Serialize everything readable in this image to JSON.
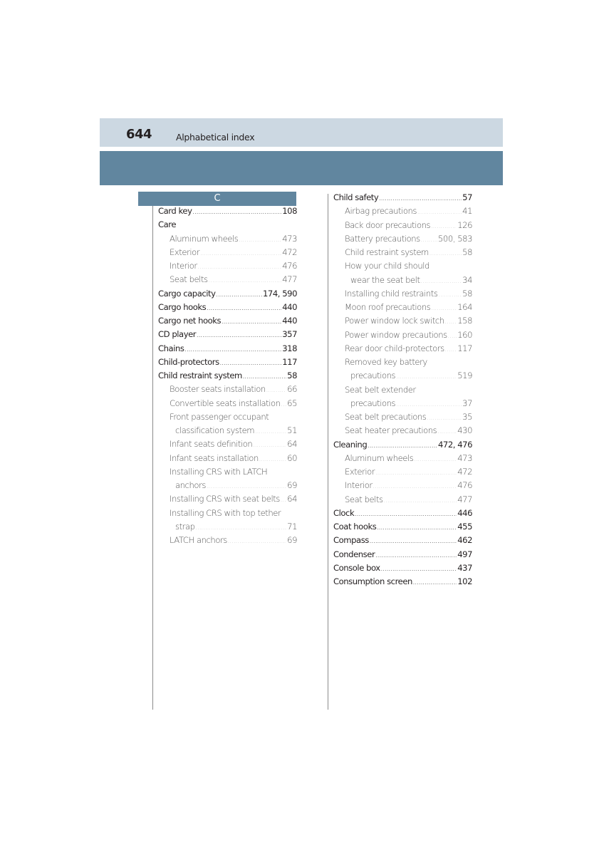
{
  "header": {
    "page_number": "644",
    "section_title": "Alphabetical index"
  },
  "letter": "C",
  "colors": {
    "header_light": "#ccd8e2",
    "header_dark": "#61869f"
  },
  "left_column": [
    {
      "label": "Card key",
      "page": "108",
      "level": 0
    },
    {
      "label": "Care",
      "page": "",
      "level": 0
    },
    {
      "label": "Aluminum wheels",
      "page": "473",
      "level": 1
    },
    {
      "label": "Exterior",
      "page": "472",
      "level": 1
    },
    {
      "label": "Interior",
      "page": "476",
      "level": 1
    },
    {
      "label": "Seat belts",
      "page": "477",
      "level": 1
    },
    {
      "label": "Cargo capacity",
      "page": "174, 590",
      "level": 0
    },
    {
      "label": "Cargo hooks",
      "page": "440",
      "level": 0
    },
    {
      "label": "Cargo net hooks",
      "page": "440",
      "level": 0
    },
    {
      "label": "CD player",
      "page": "357",
      "level": 0
    },
    {
      "label": "Chains",
      "page": "318",
      "level": 0
    },
    {
      "label": "Child-protectors",
      "page": "117",
      "level": 0
    },
    {
      "label": "Child restraint system",
      "page": "58",
      "level": 0
    },
    {
      "label": "Booster seats installation",
      "page": "66",
      "level": 1
    },
    {
      "label": "Convertible seats installation",
      "page": "65",
      "level": 1
    },
    {
      "label": "Front passenger occupant",
      "page": "",
      "level": 1
    },
    {
      "label": "classification system",
      "page": "51",
      "level": 2
    },
    {
      "label": "Infant seats definition",
      "page": "64",
      "level": 1
    },
    {
      "label": "Infant seats installation",
      "page": "60",
      "level": 1
    },
    {
      "label": "Installing CRS with LATCH",
      "page": "",
      "level": 1
    },
    {
      "label": "anchors",
      "page": "69",
      "level": 2
    },
    {
      "label": "Installing CRS with seat belts",
      "page": "64",
      "level": 1
    },
    {
      "label": "Installing CRS with top tether",
      "page": "",
      "level": 1
    },
    {
      "label": "strap",
      "page": "71",
      "level": 2
    },
    {
      "label": "LATCH anchors",
      "page": "69",
      "level": 1
    }
  ],
  "right_column": [
    {
      "label": "Child safety",
      "page": "57",
      "level": 0
    },
    {
      "label": "Airbag precautions",
      "page": "41",
      "level": 1
    },
    {
      "label": "Back door precautions",
      "page": "126",
      "level": 1
    },
    {
      "label": "Battery precautions",
      "page": "500, 583",
      "level": 1
    },
    {
      "label": "Child restraint system",
      "page": "58",
      "level": 1
    },
    {
      "label": "How your child should",
      "page": "",
      "level": 1
    },
    {
      "label": "wear the seat belt",
      "page": "34",
      "level": 2
    },
    {
      "label": "Installing child restraints",
      "page": "58",
      "level": 1
    },
    {
      "label": "Moon roof precautions",
      "page": "164",
      "level": 1
    },
    {
      "label": "Power window lock switch",
      "page": "158",
      "level": 1
    },
    {
      "label": "Power window precautions",
      "page": "160",
      "level": 1
    },
    {
      "label": "Rear door child-protectors",
      "page": "117",
      "level": 1
    },
    {
      "label": "Removed key battery",
      "page": "",
      "level": 1
    },
    {
      "label": "precautions",
      "page": "519",
      "level": 2
    },
    {
      "label": "Seat belt extender",
      "page": "",
      "level": 1
    },
    {
      "label": "precautions",
      "page": "37",
      "level": 2
    },
    {
      "label": "Seat belt precautions",
      "page": "35",
      "level": 1
    },
    {
      "label": "Seat heater precautions",
      "page": "430",
      "level": 1
    },
    {
      "label": "Cleaning",
      "page": "472, 476",
      "level": 0
    },
    {
      "label": "Aluminum wheels",
      "page": "473",
      "level": 1
    },
    {
      "label": "Exterior",
      "page": "472",
      "level": 1
    },
    {
      "label": "Interior",
      "page": "476",
      "level": 1
    },
    {
      "label": "Seat belts",
      "page": "477",
      "level": 1
    },
    {
      "label": "Clock",
      "page": "446",
      "level": 0
    },
    {
      "label": "Coat hooks",
      "page": "455",
      "level": 0
    },
    {
      "label": "Compass",
      "page": "462",
      "level": 0
    },
    {
      "label": "Condenser",
      "page": "497",
      "level": 0
    },
    {
      "label": "Console box",
      "page": "437",
      "level": 0
    },
    {
      "label": "Consumption screen",
      "page": "102",
      "level": 0
    }
  ]
}
